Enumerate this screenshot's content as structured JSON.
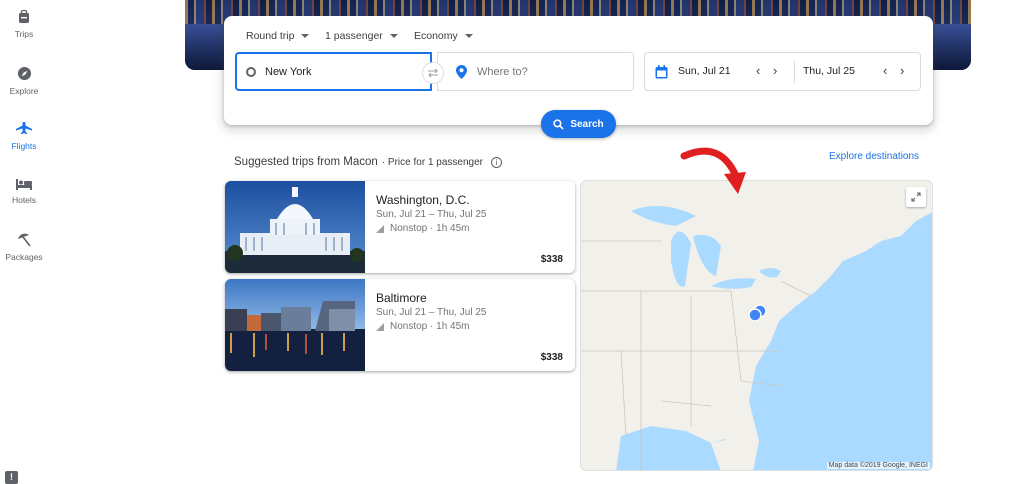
{
  "sidebar": {
    "items": [
      {
        "label": "Trips",
        "icon": "suitcase-icon"
      },
      {
        "label": "Explore",
        "icon": "compass-icon"
      },
      {
        "label": "Flights",
        "icon": "airplane-icon"
      },
      {
        "label": "Hotels",
        "icon": "bed-icon"
      },
      {
        "label": "Packages",
        "icon": "beach-umbrella-icon"
      }
    ],
    "active": "Flights"
  },
  "search": {
    "trip_type": "Round trip",
    "passengers": "1 passenger",
    "cabin": "Economy",
    "origin": "New York",
    "destination_placeholder": "Where to?",
    "depart_date": "Sun, Jul 21",
    "return_date": "Thu, Jul 25",
    "button_label": "Search"
  },
  "suggestions": {
    "title": "Suggested trips from Macon",
    "subtitle": "· Price for 1 passenger",
    "explore_link": "Explore destinations",
    "cards": [
      {
        "city": "Washington, D.C.",
        "dates": "Sun, Jul 21 – Thu, Jul 25",
        "stops": "Nonstop · 1h 45m",
        "price": "$338"
      },
      {
        "city": "Baltimore",
        "dates": "Sun, Jul 21 – Thu, Jul 25",
        "stops": "Nonstop · 1h 45m",
        "price": "$338"
      }
    ]
  },
  "map": {
    "credit": "Map data ©2019 Google, INEGI"
  },
  "colors": {
    "accent": "#1a73e8",
    "water": "#aadaff",
    "land": "#f2f0ea",
    "arrow": "#e02020"
  }
}
